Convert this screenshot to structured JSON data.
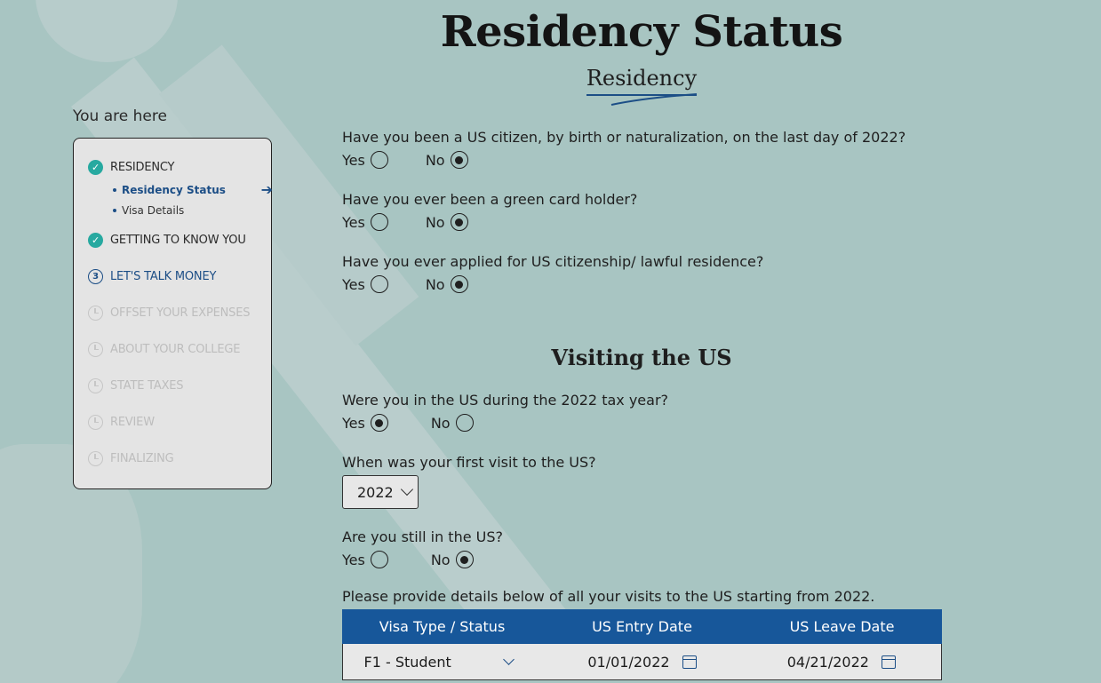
{
  "header": {
    "title": "Residency Status",
    "subtitle": "Residency"
  },
  "sidebar": {
    "you_are_here": "You are here",
    "steps": [
      {
        "label": "RESIDENCY",
        "state": "done"
      },
      {
        "label": "GETTING TO KNOW YOU",
        "state": "done"
      },
      {
        "label": "LET'S TALK MONEY",
        "state": "current",
        "number": "3"
      },
      {
        "label": "OFFSET YOUR EXPENSES",
        "state": "pending"
      },
      {
        "label": "ABOUT YOUR COLLEGE",
        "state": "pending"
      },
      {
        "label": "STATE TAXES",
        "state": "pending"
      },
      {
        "label": "REVIEW",
        "state": "pending"
      },
      {
        "label": "FINALIZING",
        "state": "pending"
      }
    ],
    "substeps": [
      {
        "label": "Residency Status",
        "active": true
      },
      {
        "label": "Visa Details",
        "active": false
      }
    ]
  },
  "questions": {
    "q1": {
      "text": "Have you been a US citizen, by birth or naturalization, on the last day of 2022?",
      "yes": "Yes",
      "no": "No",
      "selected": "no"
    },
    "q2": {
      "text": "Have you ever been a green card holder?",
      "yes": "Yes",
      "no": "No",
      "selected": "no"
    },
    "q3": {
      "text": "Have you ever applied for US citizenship/ lawful residence?",
      "yes": "Yes",
      "no": "No",
      "selected": "no"
    }
  },
  "visiting": {
    "title": "Visiting the US",
    "q4": {
      "text": "Were you in the US during the 2022 tax year?",
      "yes": "Yes",
      "no": "No",
      "selected": "yes"
    },
    "q5": {
      "text": "When was your first visit to the US?",
      "value": "2022"
    },
    "q6": {
      "text": "Are you still in the US?",
      "yes": "Yes",
      "no": "No",
      "selected": "no"
    },
    "details_text": "Please provide details below of all your visits to the US starting from 2022."
  },
  "table": {
    "headers": [
      "Visa Type / Status",
      "US Entry Date",
      "US Leave Date"
    ],
    "rows": [
      {
        "visa": "F1 - Student",
        "entry": "01/01/2022",
        "leave": "04/21/2022"
      }
    ]
  },
  "colors": {
    "background": "#a8c5c2",
    "accent": "#17579a",
    "done": "#27a9a0"
  },
  "icons": {
    "done": "check-circle-icon",
    "pending": "clock-icon",
    "arrow": "arrow-right-icon",
    "calendar": "calendar-icon"
  }
}
